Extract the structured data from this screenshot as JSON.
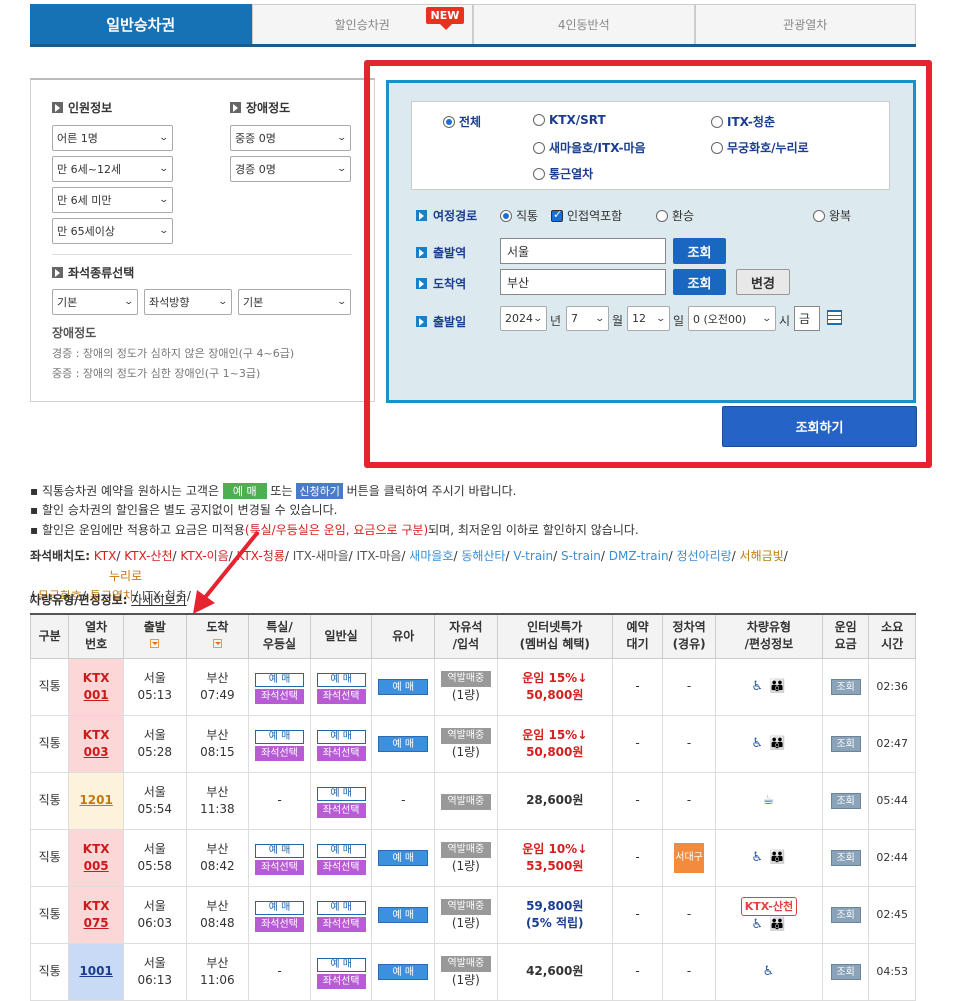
{
  "tabs": [
    {
      "label": "일반승차권"
    },
    {
      "label": "할인승차권"
    },
    {
      "label": "4인동반석"
    },
    {
      "label": "관광열차"
    }
  ],
  "new_badge": "NEW",
  "passenger": {
    "heading": "인원정보",
    "adult": "어른 1명",
    "child": "만 6세~12세",
    "infant": "만 6세 미만",
    "senior": "만 65세이상"
  },
  "disability": {
    "heading": "장애정도",
    "severe": "중증 0명",
    "mild": "경증 0명"
  },
  "seat_type": {
    "heading": "좌석종류선택",
    "opt1": "기본",
    "opt2": "좌석방향",
    "opt3": "기본"
  },
  "disability_note": {
    "heading": "장애정도",
    "mild_desc": "경증 : 장애의 정도가 심하지 않은 장애인(구 4~6급)",
    "severe_desc": "중증 : 장애의 정도가 심한 장애인(구 1~3급)"
  },
  "train_types": {
    "all": "전체",
    "ktx_srt": "KTX/SRT",
    "itx_cheongchun": "ITX-청춘",
    "saemaul": "새마을호/ITX-마음",
    "mugunghwa": "무궁화호/누리로",
    "commuter": "통근열차"
  },
  "route": {
    "label": "여정경로",
    "direct": "직통",
    "adjacent": "인접역포함",
    "transfer": "환승",
    "round": "왕복"
  },
  "departure": {
    "label": "출발역",
    "value": "서울",
    "btn": "조회"
  },
  "arrival": {
    "label": "도착역",
    "value": "부산",
    "btn": "조회",
    "swap": "변경"
  },
  "date": {
    "label": "출발일",
    "year": "2024",
    "year_unit": "년",
    "month": "7",
    "month_unit": "월",
    "day": "12",
    "day_unit": "일",
    "hour": "0 (오전00)",
    "hour_unit": "시",
    "weekday": "금"
  },
  "search_btn": "조회하기",
  "notices": {
    "n1_pre": "직통승차권 예약을 원하시는 고객은",
    "n1_btn1": "예 매",
    "n1_mid": "또는",
    "n1_btn2": "신청하기",
    "n1_post": "버튼을 클릭하여 주시기 바랍니다.",
    "n2": "할인 승차권의 할인율은 별도 공지없이 변경될 수 있습니다.",
    "n3_pre": "할인은 운임에만 적용하고 요금은 미적용",
    "n3_red": "(특실/우등실은 운임, 요금으로 구분)",
    "n3_post": "되며, 최저운임 이하로 할인하지 않습니다."
  },
  "seat_layout": {
    "label": "좌석배치도:",
    "items": [
      "KTX",
      "KTX-산천",
      "KTX-이음",
      "KTX-청룡",
      "ITX-새마을",
      "ITX-마음",
      "새마을호",
      "동해산타",
      "V-train",
      "S-train",
      "DMZ-train",
      "정선아리랑",
      "서해금빛",
      "누리로",
      "무궁화호",
      "통근열차",
      "ITX-청춘"
    ]
  },
  "vehicle_info": {
    "label": "차량유형/편성정보:",
    "link": "자세히보기"
  },
  "table": {
    "headers": [
      [
        "구분"
      ],
      [
        "열차",
        "번호"
      ],
      [
        "출발"
      ],
      [
        "도착"
      ],
      [
        "특실/",
        "우등실"
      ],
      [
        "일반실"
      ],
      [
        "유아"
      ],
      [
        "자유석",
        "/입석"
      ],
      [
        "인터넷특가",
        "(멤버십 혜택)"
      ],
      [
        "예약",
        "대기"
      ],
      [
        "정차역",
        "(경유)"
      ],
      [
        "차량유형",
        "/편성정보"
      ],
      [
        "운임",
        "요금"
      ],
      [
        "소요",
        "시간"
      ]
    ],
    "btn_book": "예 매",
    "btn_seat": "좌석선택",
    "btn_station": "역발매중",
    "btn_query": "조회",
    "car_count": "(1량)",
    "dash": "-",
    "rows": [
      {
        "type": "직통",
        "train_kind": "KTX",
        "train_no": "001",
        "dep": "서울",
        "dep_time": "05:13",
        "arr": "부산",
        "arr_time": "07:49",
        "discount": "운임 15%↓",
        "price": "50,800원",
        "duration": "02:36"
      },
      {
        "type": "직통",
        "train_kind": "KTX",
        "train_no": "003",
        "dep": "서울",
        "dep_time": "05:28",
        "arr": "부산",
        "arr_time": "08:15",
        "discount": "운임 15%↓",
        "price": "50,800원",
        "duration": "02:47"
      },
      {
        "type": "직통",
        "train_kind": "",
        "train_no": "1201",
        "dep": "서울",
        "dep_time": "05:54",
        "arr": "부산",
        "arr_time": "11:38",
        "discount": "",
        "price": "28,600원",
        "duration": "05:44"
      },
      {
        "type": "직통",
        "train_kind": "KTX",
        "train_no": "005",
        "dep": "서울",
        "dep_time": "05:58",
        "arr": "부산",
        "arr_time": "08:42",
        "discount": "운임 10%↓",
        "price": "53,500원",
        "duration": "02:44",
        "stop": "서대구"
      },
      {
        "type": "직통",
        "train_kind": "KTX",
        "train_no": "075",
        "dep": "서울",
        "dep_time": "06:03",
        "arr": "부산",
        "arr_time": "08:48",
        "discount": "",
        "price": "59,800원",
        "points": "(5% 적립)",
        "duration": "02:45",
        "vehicle_badge": "KTX-산천"
      },
      {
        "type": "직통",
        "train_kind": "",
        "train_no": "1001",
        "dep": "서울",
        "dep_time": "06:13",
        "arr": "부산",
        "arr_time": "11:06",
        "discount": "",
        "price": "42,600원",
        "duration": "04:53"
      }
    ]
  }
}
